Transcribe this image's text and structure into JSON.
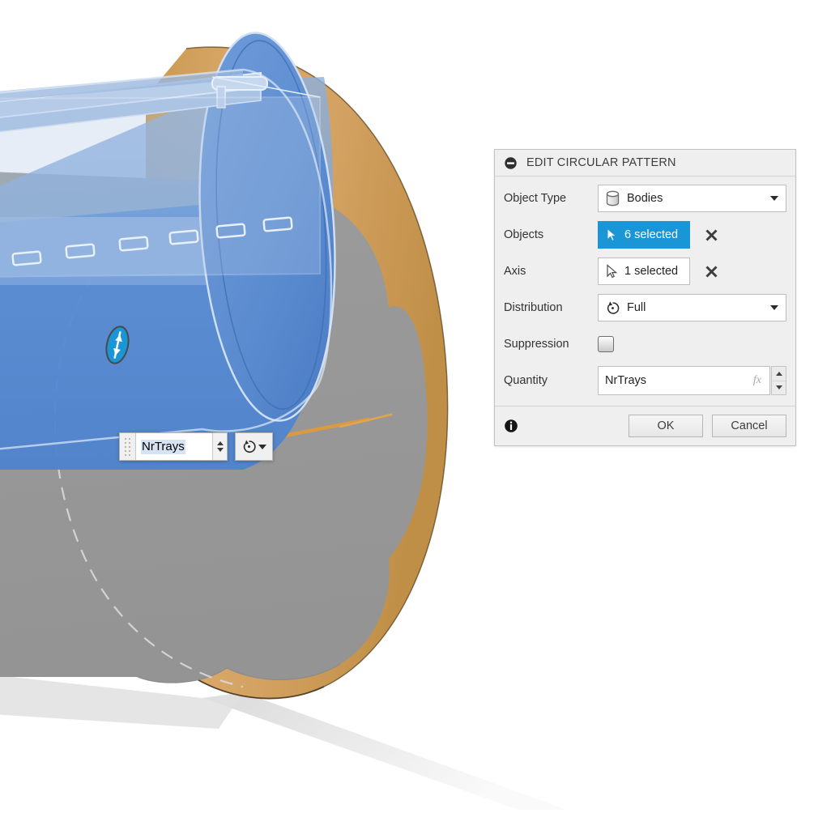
{
  "viewport": {
    "name": "cad-3d-viewport",
    "background_color": "#ffffff",
    "body_color": "#999999",
    "wood_color": "#d9a667",
    "highlight_color": "#4a86d6",
    "shadow_color": "#e3e3e3"
  },
  "canvas_widget": {
    "value": "NrTrays",
    "spin_up_icon": "triangle-up-icon",
    "spin_down_icon": "triangle-down-icon",
    "grip_icon": "drag-grip-icon",
    "button_icon": "circular-pattern-icon",
    "button_caret_icon": "chevron-down-icon"
  },
  "manipulator": {
    "handle_icon": "double-arrow-drag-handle-icon",
    "color": "#1a95d5"
  },
  "dialog": {
    "title": "EDIT CIRCULAR PATTERN",
    "collapse_icon": "collapse-minus-icon",
    "rows": {
      "object_type": {
        "label": "Object Type",
        "value": "Bodies",
        "icon": "body-cylinder-icon",
        "caret_icon": "chevron-down-icon"
      },
      "objects": {
        "label": "Objects",
        "value": "6 selected",
        "icon": "selection-cursor-icon",
        "clear_icon": "close-x-icon",
        "state": "active"
      },
      "axis": {
        "label": "Axis",
        "value": "1 selected",
        "icon": "selection-cursor-icon",
        "clear_icon": "close-x-icon",
        "state": "idle"
      },
      "distribution": {
        "label": "Distribution",
        "value": "Full",
        "icon": "circular-distribution-icon",
        "caret_icon": "chevron-down-icon"
      },
      "suppression": {
        "label": "Suppression",
        "checked": false
      },
      "quantity": {
        "label": "Quantity",
        "value": "NrTrays",
        "fx_label": "fx",
        "spin_up_icon": "triangle-up-icon",
        "spin_down_icon": "triangle-down-icon"
      }
    },
    "footer": {
      "info_icon": "info-circle-icon",
      "ok_label": "OK",
      "cancel_label": "Cancel"
    },
    "colors": {
      "accent": "#1a95d5",
      "panel_bg": "#efefef",
      "field_bg": "#ffffff",
      "border": "#c2c2c2",
      "text": "#333333"
    }
  }
}
